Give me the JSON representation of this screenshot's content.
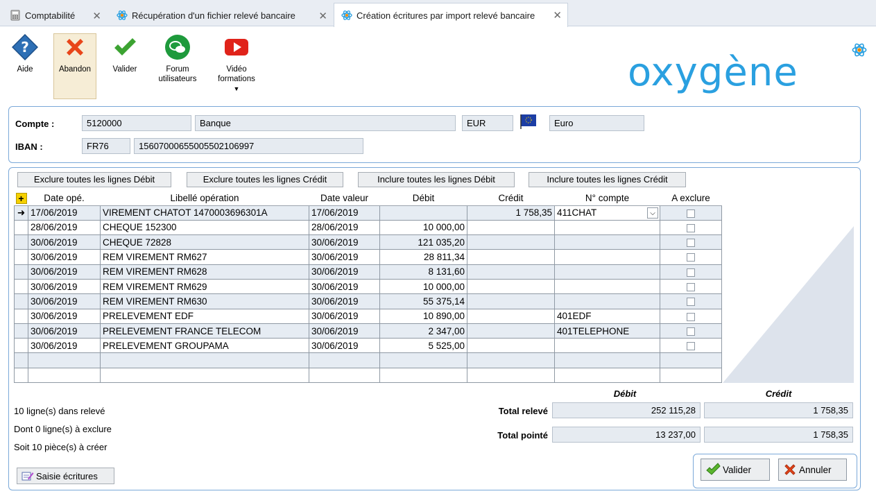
{
  "tabs": [
    {
      "label": "Comptabilité"
    },
    {
      "label": "Récupération d'un fichier relevé bancaire"
    },
    {
      "label": "Création écritures par import relevé bancaire"
    }
  ],
  "toolbar": {
    "aide": "Aide",
    "abandon": "Abandon",
    "valider": "Valider",
    "forum_l1": "Forum",
    "forum_l2": "utilisateurs",
    "video_l1": "Vidéo",
    "video_l2": "formations"
  },
  "brand": "oxygène",
  "account": {
    "compte_label": "Compte :",
    "compte_num": "5120000",
    "compte_name": "Banque",
    "currency_code": "EUR",
    "currency_name": "Euro",
    "iban_label": "IBAN :",
    "iban_prefix": "FR76",
    "iban_rest": "15607000655005502106997"
  },
  "actions": {
    "exclude_debit": "Exclure toutes les lignes Débit",
    "exclude_credit": "Exclure toutes les lignes Crédit",
    "include_debit": "Inclure toutes les lignes Débit",
    "include_credit": "Inclure toutes les lignes Crédit"
  },
  "grid": {
    "headers": [
      "Date opé.",
      "Libellé opération",
      "Date valeur",
      "Débit",
      "Crédit",
      "N° compte",
      "A exclure"
    ],
    "rows": [
      {
        "date_op": "17/06/2019",
        "libelle": "VIREMENT CHATOT 1470003696301A",
        "date_valeur": "17/06/2019",
        "debit": "",
        "credit": "1 758,35",
        "compte": "411CHAT",
        "exclude": false
      },
      {
        "date_op": "28/06/2019",
        "libelle": "CHEQUE 152300",
        "date_valeur": "28/06/2019",
        "debit": "10 000,00",
        "credit": "",
        "compte": "",
        "exclude": false
      },
      {
        "date_op": "30/06/2019",
        "libelle": "CHEQUE 72828",
        "date_valeur": "30/06/2019",
        "debit": "121 035,20",
        "credit": "",
        "compte": "",
        "exclude": false
      },
      {
        "date_op": "30/06/2019",
        "libelle": "REM VIREMENT RM627",
        "date_valeur": "30/06/2019",
        "debit": "28 811,34",
        "credit": "",
        "compte": "",
        "exclude": false
      },
      {
        "date_op": "30/06/2019",
        "libelle": "REM VIREMENT RM628",
        "date_valeur": "30/06/2019",
        "debit": "8 131,60",
        "credit": "",
        "compte": "",
        "exclude": false
      },
      {
        "date_op": "30/06/2019",
        "libelle": "REM VIREMENT RM629",
        "date_valeur": "30/06/2019",
        "debit": "10 000,00",
        "credit": "",
        "compte": "",
        "exclude": false
      },
      {
        "date_op": "30/06/2019",
        "libelle": "REM VIREMENT RM630",
        "date_valeur": "30/06/2019",
        "debit": "55 375,14",
        "credit": "",
        "compte": "",
        "exclude": false
      },
      {
        "date_op": "30/06/2019",
        "libelle": "PRELEVEMENT EDF",
        "date_valeur": "30/06/2019",
        "debit": "10 890,00",
        "credit": "",
        "compte": "401EDF",
        "exclude": false
      },
      {
        "date_op": "30/06/2019",
        "libelle": "PRELEVEMENT FRANCE TELECOM",
        "date_valeur": "30/06/2019",
        "debit": "2 347,00",
        "credit": "",
        "compte": "401TELEPHONE",
        "exclude": false
      },
      {
        "date_op": "30/06/2019",
        "libelle": "PRELEVEMENT GROUPAMA",
        "date_valeur": "30/06/2019",
        "debit": "5 525,00",
        "credit": "",
        "compte": "",
        "exclude": false
      }
    ]
  },
  "summary": {
    "lines_in_statement": "10 ligne(s) dans relevé",
    "lines_to_exclude": "Dont 0 ligne(s) à exclure",
    "pieces_to_create": "Soit 10 pièce(s) à créer",
    "debit_head": "Débit",
    "credit_head": "Crédit",
    "total_releve_label": "Total relevé",
    "total_releve_debit": "252 115,28",
    "total_releve_credit": "1 758,35",
    "total_pointe_label": "Total pointé",
    "total_pointe_debit": "13 237,00",
    "total_pointe_credit": "1 758,35"
  },
  "footer": {
    "saisie": "Saisie écritures",
    "valider": "Valider",
    "annuler": "Annuler"
  },
  "colors": {
    "accent": "#2aa0e0",
    "panel_border": "#7aa8d8",
    "row_alt": "#e6ecf3"
  }
}
